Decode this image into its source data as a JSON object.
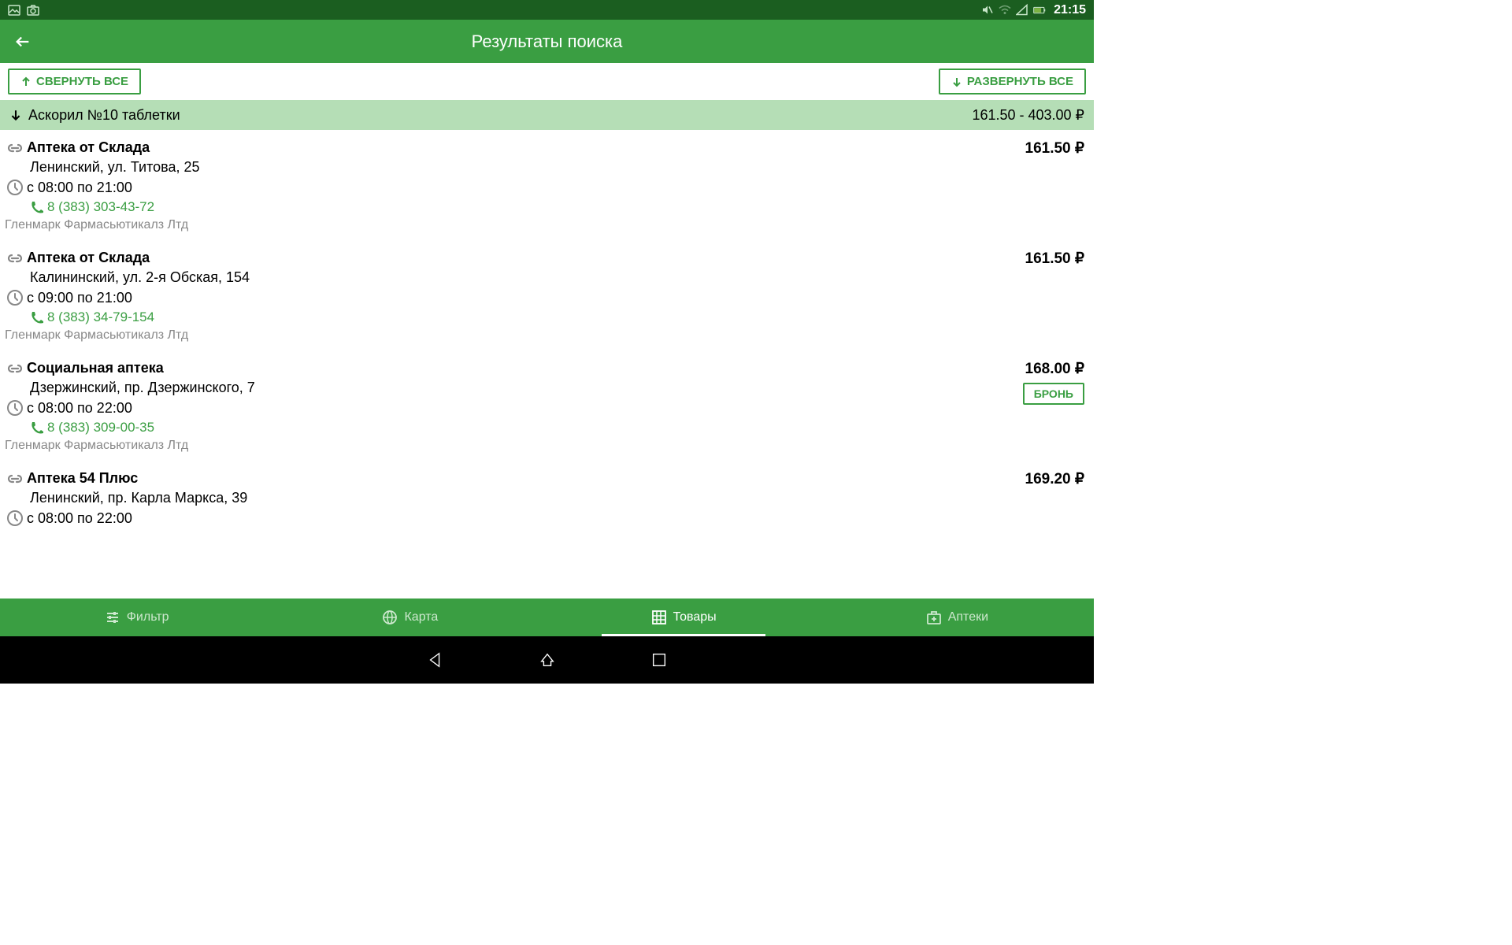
{
  "status": {
    "time": "21:15"
  },
  "header": {
    "title": "Результаты поиска"
  },
  "controls": {
    "collapse": "СВЕРНУТЬ ВСЕ",
    "expand": "РАЗВЕРНУТЬ ВСЕ"
  },
  "product": {
    "name": "Аскорил №10 таблетки",
    "price_range": "161.50 - 403.00 ₽"
  },
  "results": [
    {
      "name": "Аптека от Склада",
      "address": "Ленинский, ул. Титова, 25",
      "hours": "с 08:00 по 21:00",
      "phone": "8 (383) 303-43-72",
      "manufacturer": "Гленмарк Фармасьютикалз Лтд",
      "price": "161.50 ₽",
      "reserve": false
    },
    {
      "name": "Аптека от Склада",
      "address": "Калининский, ул. 2-я Обская, 154",
      "hours": "с 09:00 по 21:00",
      "phone": "8 (383) 34-79-154",
      "manufacturer": "Гленмарк Фармасьютикалз Лтд",
      "price": "161.50 ₽",
      "reserve": false
    },
    {
      "name": "Социальная аптека",
      "address": "Дзержинский, пр. Дзержинского, 7",
      "hours": "с 08:00 по 22:00",
      "phone": "8 (383) 309-00-35",
      "manufacturer": "Гленмарк Фармасьютикалз Лтд",
      "price": "168.00 ₽",
      "reserve": true,
      "reserve_label": "БРОНЬ"
    },
    {
      "name": "Аптека 54 Плюс",
      "address": "Ленинский, пр. Карла Маркса, 39",
      "hours": "с 08:00 по 22:00",
      "phone": "",
      "manufacturer": "",
      "price": "169.20 ₽",
      "reserve": false
    }
  ],
  "tabs": {
    "filter": "Фильтр",
    "map": "Карта",
    "goods": "Товары",
    "pharmacies": "Аптеки"
  }
}
